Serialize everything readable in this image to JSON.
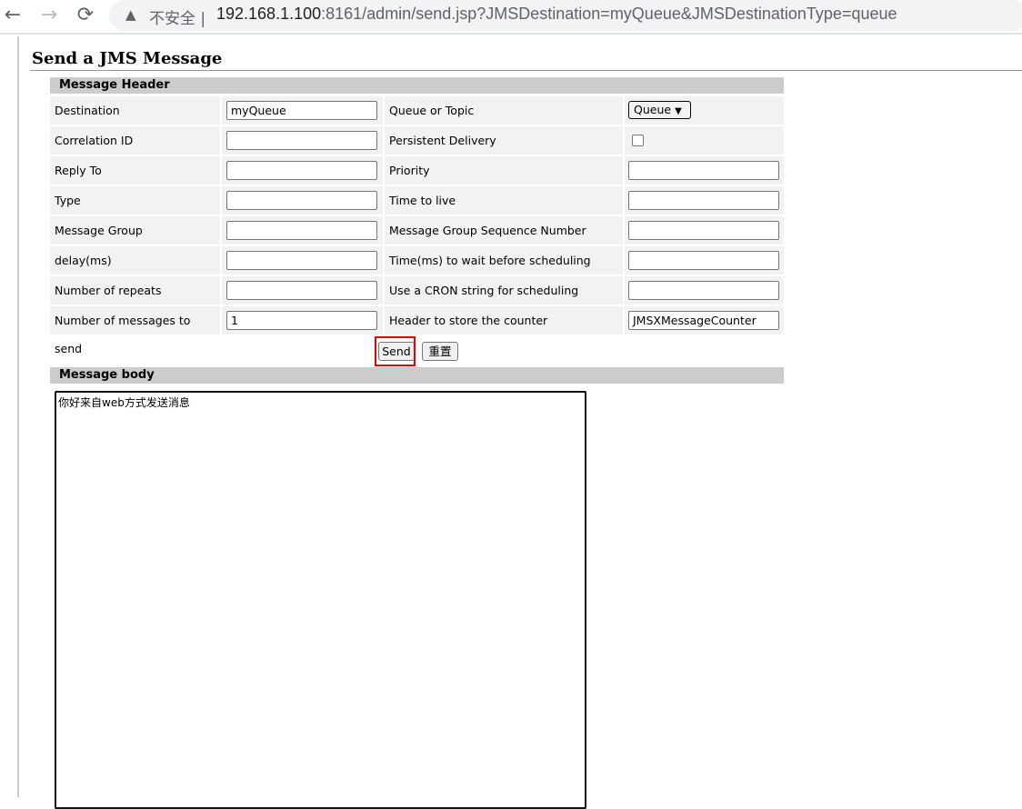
{
  "browser": {
    "back_icon": "←",
    "forward_icon": "→",
    "reload_icon": "⟳",
    "warning_icon": "▲",
    "security_label": "不安全 |",
    "url_host": "192.168.1.100",
    "url_rest": ":8161/admin/send.jsp?JMSDestination=myQueue&JMSDestinationType=queue"
  },
  "page": {
    "title": "Send a JMS Message"
  },
  "header_section": {
    "title": "Message Header"
  },
  "rows": [
    {
      "label": "Destination",
      "value": "myQueue",
      "label2": "Queue or Topic",
      "value2": ""
    },
    {
      "label": "Correlation ID",
      "value": "",
      "label2": "Persistent Delivery",
      "value2": ""
    },
    {
      "label": "Reply To",
      "value": "",
      "label2": "Priority",
      "value2": ""
    },
    {
      "label": "Type",
      "value": "",
      "label2": "Time to live",
      "value2": ""
    },
    {
      "label": "Message Group",
      "value": "",
      "label2": "Message Group Sequence Number",
      "value2": ""
    },
    {
      "label": "delay(ms)",
      "value": "",
      "label2": "Time(ms) to wait before scheduling again",
      "value2": ""
    },
    {
      "label": "Number of repeats",
      "value": "",
      "label2": "Use a CRON string for scheduling",
      "value2": ""
    },
    {
      "label": "Number of messages to send",
      "value": "1",
      "label2": "Header to store the counter",
      "value2": "JMSXMessageCounter"
    }
  ],
  "queue_or_topic": {
    "selected": "Queue"
  },
  "persistent_delivery": {
    "checked": false
  },
  "buttons": {
    "send": "Send",
    "reset": "重置"
  },
  "body_section": {
    "title": "Message body",
    "value": "你好来自web方式发送消息"
  }
}
